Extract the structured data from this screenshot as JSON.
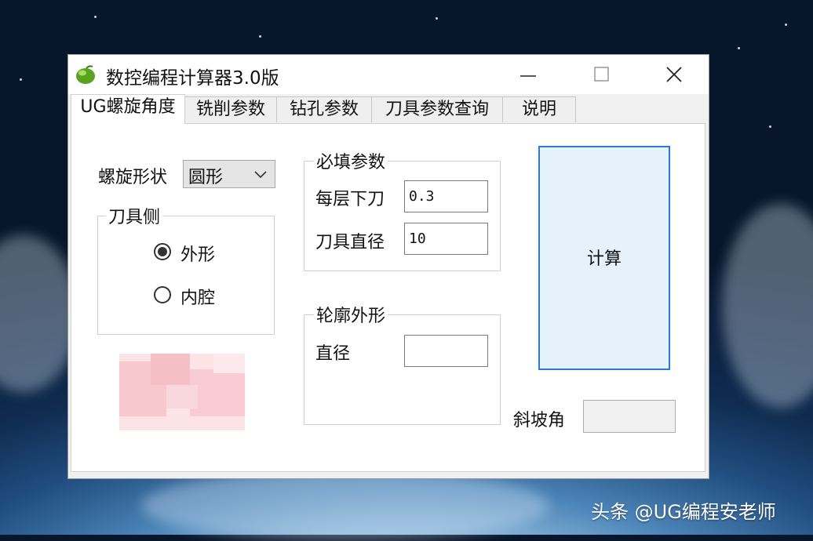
{
  "window": {
    "title": "数控编程计算器3.0版"
  },
  "tabs": [
    {
      "label": "UG螺旋角度",
      "active": true
    },
    {
      "label": "铣削参数",
      "active": false
    },
    {
      "label": "钻孔参数",
      "active": false
    },
    {
      "label": "刀具参数查询",
      "active": false
    },
    {
      "label": "说明",
      "active": false
    }
  ],
  "form": {
    "shape_label": "螺旋形状",
    "shape_value": "圆形",
    "tool_side": {
      "title": "刀具侧",
      "options": [
        {
          "label": "外形",
          "checked": true
        },
        {
          "label": "内腔",
          "checked": false
        }
      ]
    },
    "required": {
      "title": "必填参数",
      "step_down_label": "每层下刀",
      "step_down_value": "0.3",
      "tool_diameter_label": "刀具直径",
      "tool_diameter_value": "10"
    },
    "contour": {
      "title": "轮廓外形",
      "diameter_label": "直径",
      "diameter_value": ""
    },
    "calc_label": "计算",
    "ramp_label": "斜坡角",
    "ramp_value": ""
  },
  "watermark": "头条 @UG编程安老师",
  "colors": {
    "accent_border": "#2a7ad2",
    "button_fill": "#e5f1fb",
    "icon_green": "#5aa321"
  },
  "icons": [
    "app-logo-icon",
    "minimize-icon",
    "maximize-icon",
    "close-icon",
    "chevron-down-icon"
  ]
}
